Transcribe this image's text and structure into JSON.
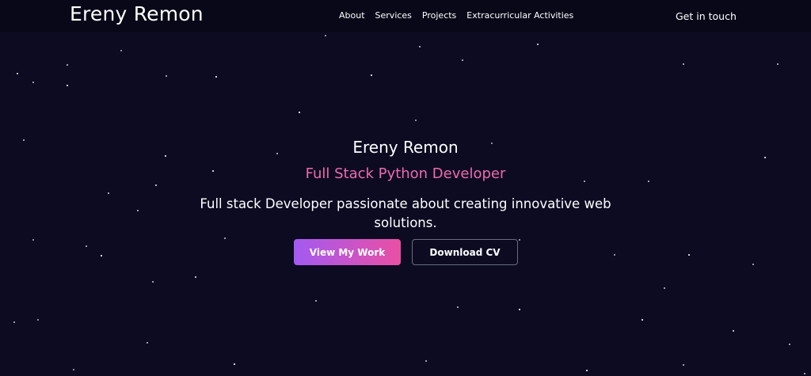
{
  "navbar": {
    "brand": "Ereny Remon",
    "links": [
      "About",
      "Services",
      "Projects",
      "Extracurricular Activities"
    ],
    "cta": "Get in touch"
  },
  "hero": {
    "name": "Ereny Remon",
    "role": "Full Stack Python Developer",
    "description": "Full stack Developer passionate about creating innovative web solutions.",
    "primary_button": "View My Work",
    "secondary_button": "Download CV"
  },
  "colors": {
    "background": "#0c0b22",
    "nav_background": "#090818",
    "accent_pink": "#ef6ab0",
    "gradient_start": "#a35af2",
    "gradient_end": "#ea4fa4"
  }
}
